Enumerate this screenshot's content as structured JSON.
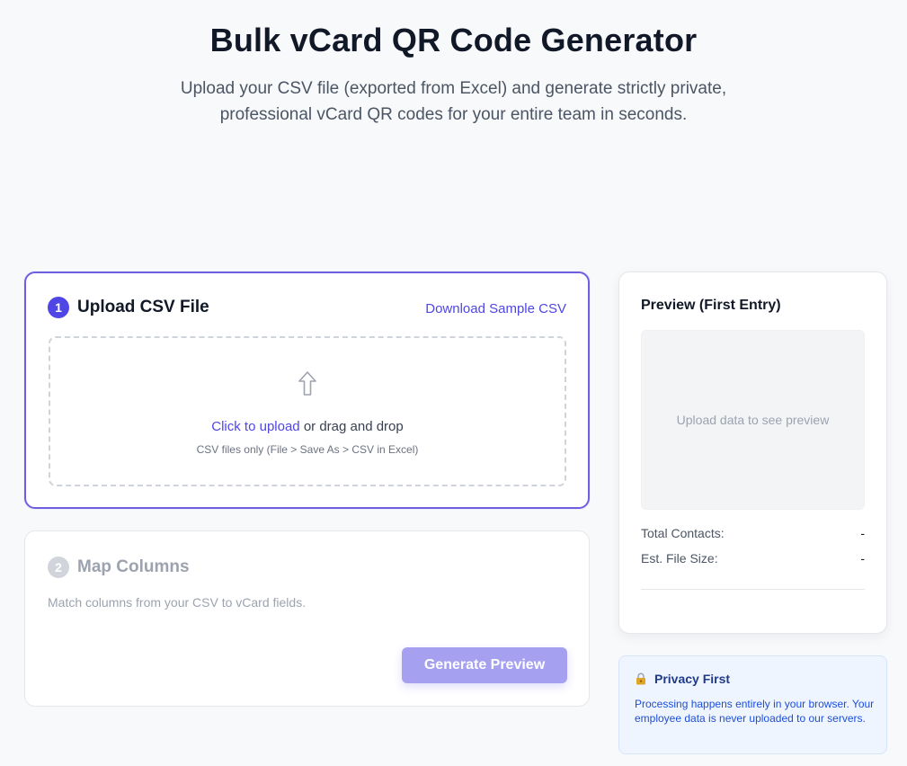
{
  "header": {
    "title": "Bulk vCard QR Code Generator",
    "subtitle_line1": "Upload your CSV file (exported from Excel) and generate strictly private,",
    "subtitle_line2": "professional vCard QR codes for your entire team in seconds."
  },
  "upload": {
    "step_number": "1",
    "title": "Upload CSV File",
    "sample_link": "Download Sample CSV",
    "click_to_upload": "Click to upload",
    "drag_text": " or drag and drop",
    "hint": "CSV files only (File > Save As > CSV in Excel)",
    "icon": "arrow-up-icon"
  },
  "map": {
    "step_number": "2",
    "title": "Map Columns",
    "description": "Match columns from your CSV to vCard fields.",
    "button_label": "Generate Preview"
  },
  "preview": {
    "title": "Preview (First Entry)",
    "placeholder": "Upload data to see preview",
    "total_contacts_label": "Total Contacts:",
    "total_contacts_value": "-",
    "file_size_label": "Est. File Size:",
    "file_size_value": "-"
  },
  "privacy": {
    "icon": "lock-icon",
    "title": "Privacy First",
    "text": "Processing happens entirely in your browser. Your employee data is never uploaded to our servers."
  },
  "colors": {
    "accent": "#4f46e5",
    "accent_disabled": "#a5a0ef",
    "active_border": "#6d5fe0",
    "privacy_bg": "#eff5ff"
  }
}
